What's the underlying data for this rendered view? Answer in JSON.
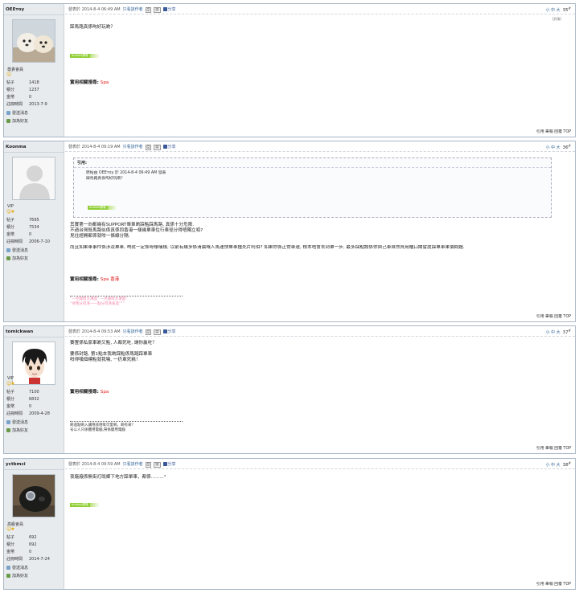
{
  "posts": [
    {
      "username": "ОЕЕтоу",
      "group": "尊貴會員",
      "stats": [
        {
          "k": "帖子",
          "v": "1418"
        },
        {
          "k": "積分",
          "v": "1237"
        },
        {
          "k": "金幣",
          "v": "0"
        },
        {
          "k": "註冊時間",
          "v": "2013-7-9"
        }
      ],
      "send_msg": "發送消息",
      "add_friend": "加為好友",
      "time": "發表於 2014-8-4 06:49 AM",
      "only_author": "只看該作者",
      "share": "分享",
      "font_sizes": "小 中 大",
      "floor": "35",
      "detail_tag": "[詳情]",
      "body": [
        "踩馬路真係呴好玩啲？"
      ],
      "app_badge": "Android廣場",
      "related_label": "實用相關搜尋:",
      "related": "Spa",
      "footer": "引用 舉報 回覆 TOP"
    },
    {
      "username": "Koonma",
      "group": "VIP",
      "stats": [
        {
          "k": "帖子",
          "v": "7695"
        },
        {
          "k": "積分",
          "v": "7534"
        },
        {
          "k": "金幣",
          "v": "0"
        },
        {
          "k": "註冊時間",
          "v": "2006-7-10"
        }
      ],
      "send_msg": "發送消息",
      "add_friend": "加為好友",
      "time": "發表於 2014-8-4 09:19 AM",
      "only_author": "只看該作者",
      "share": "分享",
      "font_sizes": "小 中 大",
      "floor": "36",
      "quote_title": "引用:",
      "quote_meta": "原帖由 ОЕЕтоу 於 2014-8-4 06:49 AM 發表",
      "quote_text": "踩馬路真係呴好玩啲？",
      "app_badge": "Android廣場",
      "body": [
        "其實第一向都幾有SUPPORT單車啲踩點踩馬路, 真係十分危險.",
        "不過台灣既馬路似係真係同香港一樣幾單車住行車徑分得唔獨立呱?",
        "見往經開都係就咁一條線分隔.",
        "",
        "而且如果車事件係涉及單車, 呴就一定係呀樣嘆樣, 以前有幾多係清晨嘅人馬速快單車撞死片阿伯? 如果你係正常車速, 根本唔會去到單一步, 最多踩點該係你自己車自然買用櫃口聞譬度踩單車果個問題."
      ],
      "related_label": "實用相關搜尋:",
      "related": "Spa 香港",
      "sig_pink": [
        "”一見鐘情太薄面” 一見鐘情太薄面”",
        "”待我分得清一一點分得清毫過”””"
      ],
      "footer": "引用 舉報 回覆 TOP"
    },
    {
      "username": "tomickwan",
      "group": "VIP",
      "stats": [
        {
          "k": "帖子",
          "v": "7100"
        },
        {
          "k": "積分",
          "v": "6832"
        },
        {
          "k": "金幣",
          "v": "0"
        },
        {
          "k": "註冊時間",
          "v": "2009-4-28"
        }
      ],
      "send_msg": "發送消息",
      "add_friend": "加為好友",
      "time": "發表於 2014-8-4 09:53 AM",
      "only_author": "只看該作者",
      "share": "分享",
      "font_sizes": "小 中 大",
      "floor": "37",
      "body": [
        "賽置係私家車啲又點, 人都死咗, 讓你贏咗？",
        "",
        "要係封路, 第1點本我啲踩點係馬路踩單車",
        "咁得嘆個標點就我犧, 一扔車死糕！"
      ],
      "related_label": "實用相關搜尋:",
      "related": "Spa",
      "sig": [
        "啲過點啲入讓咆該咁呲可愛啲，啲有來？",
        "号公人只係體用電腦,帶係變用電腦"
      ],
      "footer": "引用 舉報 回覆 TOP"
    },
    {
      "username": "yctbmci",
      "group": "高級會員",
      "stats": [
        {
          "k": "帖子",
          "v": "692"
        },
        {
          "k": "積分",
          "v": "692"
        },
        {
          "k": "金幣",
          "v": "0"
        },
        {
          "k": "註冊時間",
          "v": "2014-7-24"
        }
      ],
      "send_msg": "發送消息",
      "add_friend": "加為好友",
      "time": "發表於 2014-8-4 09:59 AM",
      "only_author": "只看該作者",
      "share": "分享",
      "font_sizes": "小 中 大",
      "floor": "38",
      "body": [
        "夜廠廠係無街灯既鄉下地方踩單車，都係.........°"
      ],
      "app_badge": "Android廣場",
      "footer": "引用 舉報 回覆 TOP"
    }
  ]
}
